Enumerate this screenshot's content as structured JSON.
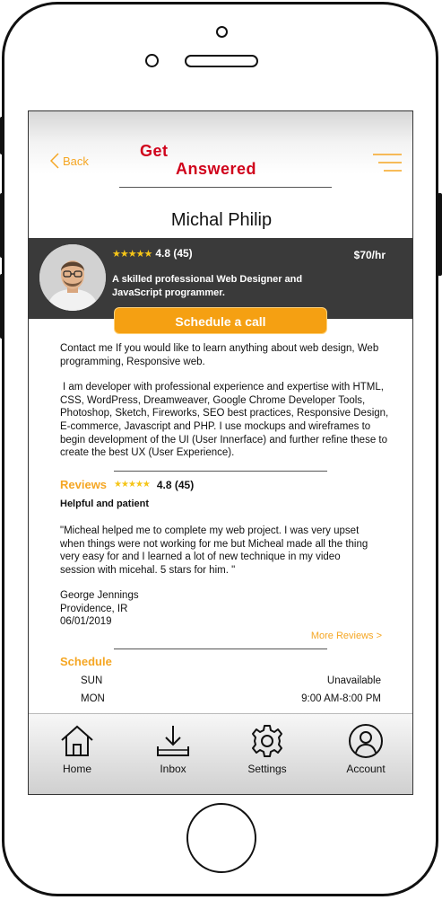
{
  "header": {
    "back_label": "Back",
    "logo_line1": "Get",
    "logo_line2": "Answered"
  },
  "profile": {
    "name": "Michal Philip",
    "stars": "★★★★★",
    "rating": "4.8 (45)",
    "price": "$70/hr",
    "bio": "A skilled professional Web Designer and JavaScript programmer.",
    "cta_label": "Schedule a call"
  },
  "about": {
    "paragraph1": "Contact me If you would like to learn anything about web design, Web programming, Responsive web.",
    "paragraph2": "I am developer with professional experience and expertise with HTML, CSS, WordPress, Dreamweaver, Google Chrome Developer Tools, Photoshop, Sketch, Fireworks, SEO best practices, Responsive Design, E-commerce, Javascript and PHP. I use mockups and wireframes to begin development of the UI (User Innerface) and further refine these to create the best UX (User Experience)."
  },
  "reviews": {
    "title": "Reviews",
    "stars": "★★★★★",
    "rating": "4.8 (45)",
    "subtitle": "Helpful and patient",
    "text": "\"Micheal  helped me to complete my web project. I was very upset when things were not working for me but Micheal made all the thing very easy for and I learned a lot of new technique in my video session with micehal. 5 stars for him. \"",
    "author_name": "George Jennings",
    "author_location": "Providence, IR",
    "date": "06/01/2019",
    "more_label": "More Reviews >"
  },
  "schedule": {
    "title": "Schedule",
    "rows": [
      {
        "day": "SUN",
        "hours": "Unavailable"
      },
      {
        "day": "MON",
        "hours": "9:00 AM-8:00 PM"
      }
    ]
  },
  "nav": {
    "items": [
      {
        "label": "Home",
        "icon": "home-icon"
      },
      {
        "label": "Inbox",
        "icon": "inbox-icon"
      },
      {
        "label": "Settings",
        "icon": "gear-icon"
      },
      {
        "label": "Account",
        "icon": "account-icon"
      }
    ]
  },
  "colors": {
    "accent": "#f5a623",
    "brand_red": "#d0021b",
    "band": "#3a3a3a",
    "star": "#f5c518"
  }
}
